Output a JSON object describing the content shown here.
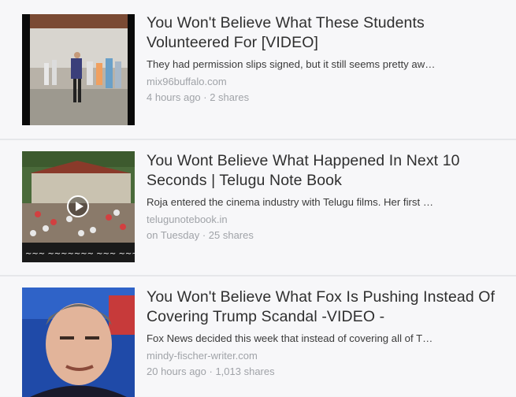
{
  "feed": {
    "items": [
      {
        "title": "You Won't Believe What These Students Volunteered For [VIDEO]",
        "description": "They had permission slips signed, but it still seems pretty aw…",
        "source": "mix96buffalo.com",
        "meta": "4 hours ago · 2 shares",
        "thumbnail_icon": "video-thumbnail-students"
      },
      {
        "title": "You Wont Believe What Happened In Next 10 Seconds | Telugu Note Book",
        "description": "Roja entered the cinema industry with Telugu films. Her first …",
        "source": "telugunotebook.in",
        "meta": "on Tuesday · 25 shares",
        "thumbnail_icon": "video-thumbnail-crowd"
      },
      {
        "title": "You Won't Believe What Fox Is Pushing Instead Of Covering Trump Scandal -VIDEO -",
        "description": "Fox News decided this week that instead of covering all of T…",
        "source": "mindy-fischer-writer.com",
        "meta": "20 hours ago · 1,013 shares",
        "thumbnail_icon": "photo-thumbnail-anchor"
      }
    ]
  },
  "colors": {
    "title": "#2f2f2f",
    "muted": "#a0a3a8",
    "background": "#f7f7f9"
  }
}
